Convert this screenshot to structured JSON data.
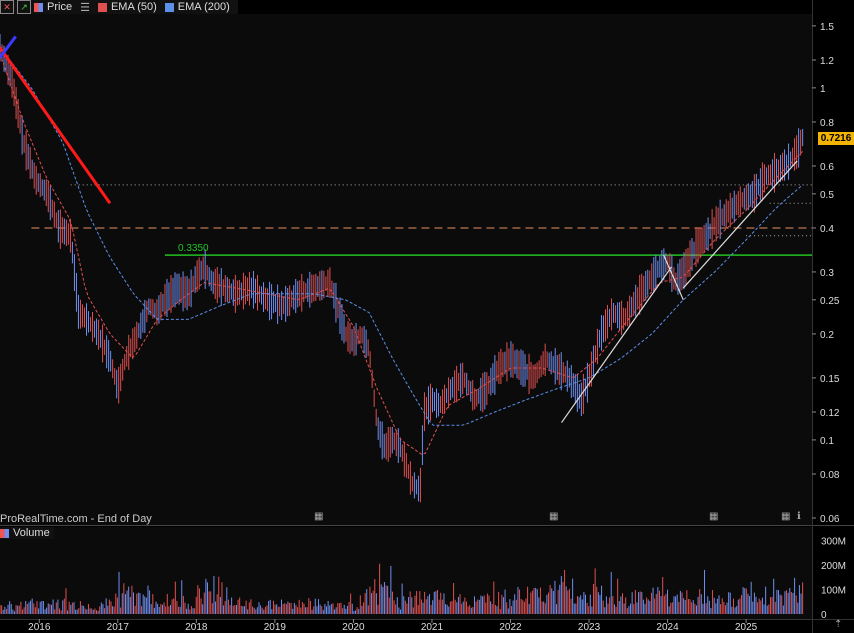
{
  "legend": {
    "price_label": "Price",
    "ema50_label": "EMA (50)",
    "ema200_label": "EMA (200)",
    "price_color": "#6f8ff0",
    "ema50_color": "#e05050",
    "ema200_color": "#5b8fe8"
  },
  "watermark": "ProRealTime.com - End of Day",
  "volume_label": "Volume",
  "last_price": "0.7216",
  "level_label": "0.3350",
  "chart_data": [
    {
      "type": "line",
      "scale": "log",
      "ylim": [
        0.06,
        1.6
      ],
      "xlim": [
        2015.5,
        2025.75
      ],
      "y_ticks": [
        "1.5",
        "1.2",
        "1",
        "0.8",
        "0.7216",
        "0.6",
        "0.5",
        "0.4",
        "0.3",
        "0.25",
        "0.2",
        "0.15",
        "0.12",
        "0.1",
        "0.08",
        "0.06"
      ],
      "y_tick_values": [
        1.5,
        1.2,
        1.0,
        0.8,
        0.7216,
        0.6,
        0.5,
        0.4,
        0.3,
        0.25,
        0.2,
        0.15,
        0.12,
        0.1,
        0.08,
        0.06
      ],
      "series": [
        {
          "name": "Price",
          "x": [
            2015.5,
            2015.65,
            2015.8,
            2015.95,
            2016.1,
            2016.25,
            2016.4,
            2016.5,
            2016.6,
            2016.75,
            2016.9,
            2017.0,
            2017.1,
            2017.25,
            2017.4,
            2017.5,
            2017.6,
            2017.75,
            2017.9,
            2018.0,
            2018.1,
            2018.2,
            2018.35,
            2018.5,
            2018.7,
            2018.9,
            2019.1,
            2019.3,
            2019.5,
            2019.7,
            2019.9,
            2020.0,
            2020.1,
            2020.2,
            2020.3,
            2020.4,
            2020.5,
            2020.6,
            2020.75,
            2020.85,
            2020.9,
            2021.0,
            2021.1,
            2021.25,
            2021.4,
            2021.55,
            2021.7,
            2021.85,
            2022.0,
            2022.15,
            2022.3,
            2022.45,
            2022.6,
            2022.75,
            2022.9,
            2023.0,
            2023.15,
            2023.3,
            2023.45,
            2023.6,
            2023.75,
            2023.9,
            2024.0,
            2024.1,
            2024.2,
            2024.35,
            2024.5,
            2024.65,
            2024.8,
            2024.95,
            2025.1,
            2025.25,
            2025.4,
            2025.55,
            2025.65,
            2025.72
          ],
          "values": [
            1.3,
            1.05,
            0.7,
            0.55,
            0.5,
            0.4,
            0.38,
            0.23,
            0.22,
            0.2,
            0.17,
            0.14,
            0.17,
            0.2,
            0.24,
            0.23,
            0.25,
            0.27,
            0.26,
            0.29,
            0.31,
            0.28,
            0.27,
            0.26,
            0.27,
            0.25,
            0.24,
            0.26,
            0.27,
            0.28,
            0.2,
            0.19,
            0.2,
            0.18,
            0.11,
            0.095,
            0.1,
            0.095,
            0.075,
            0.072,
            0.12,
            0.13,
            0.125,
            0.14,
            0.15,
            0.13,
            0.14,
            0.16,
            0.17,
            0.16,
            0.15,
            0.17,
            0.16,
            0.15,
            0.13,
            0.15,
            0.2,
            0.23,
            0.22,
            0.25,
            0.28,
            0.31,
            0.32,
            0.28,
            0.3,
            0.35,
            0.38,
            0.42,
            0.45,
            0.48,
            0.5,
            0.56,
            0.58,
            0.62,
            0.66,
            0.7216
          ]
        },
        {
          "name": "EMA (50)",
          "x": [
            2015.5,
            2015.8,
            2016.1,
            2016.4,
            2016.6,
            2016.9,
            2017.2,
            2017.5,
            2017.8,
            2018.1,
            2018.5,
            2018.9,
            2019.3,
            2019.7,
            2020.0,
            2020.3,
            2020.6,
            2020.9,
            2021.2,
            2021.6,
            2022.0,
            2022.4,
            2022.8,
            2023.1,
            2023.5,
            2023.9,
            2024.2,
            2024.6,
            2025.0,
            2025.4,
            2025.72
          ],
          "values": [
            1.25,
            0.8,
            0.55,
            0.42,
            0.26,
            0.2,
            0.17,
            0.22,
            0.25,
            0.28,
            0.27,
            0.26,
            0.25,
            0.27,
            0.21,
            0.14,
            0.1,
            0.09,
            0.125,
            0.14,
            0.16,
            0.16,
            0.15,
            0.17,
            0.22,
            0.28,
            0.29,
            0.37,
            0.45,
            0.56,
            0.66
          ]
        },
        {
          "name": "EMA (200)",
          "x": [
            2015.5,
            2015.9,
            2016.3,
            2016.6,
            2016.9,
            2017.2,
            2017.5,
            2017.9,
            2018.3,
            2018.7,
            2019.1,
            2019.5,
            2019.9,
            2020.2,
            2020.5,
            2020.8,
            2021.0,
            2021.4,
            2021.8,
            2022.2,
            2022.6,
            2023.0,
            2023.4,
            2023.8,
            2024.2,
            2024.6,
            2025.0,
            2025.4,
            2025.72
          ],
          "values": [
            1.3,
            1.0,
            0.7,
            0.45,
            0.33,
            0.26,
            0.22,
            0.22,
            0.24,
            0.26,
            0.26,
            0.26,
            0.25,
            0.23,
            0.17,
            0.13,
            0.11,
            0.11,
            0.12,
            0.13,
            0.14,
            0.15,
            0.17,
            0.2,
            0.25,
            0.3,
            0.37,
            0.46,
            0.53
          ]
        }
      ],
      "levels": [
        {
          "name": "0.3350",
          "value": 0.335,
          "color": "#22c422",
          "style": "solid",
          "x_start": 2017.6
        },
        {
          "value": 0.4,
          "color": "#e89060",
          "style": "dashed",
          "x_start": 2015.9
        },
        {
          "value": 0.38,
          "color": "#aaaaaa",
          "style": "dotted",
          "x_start": 2025.0
        },
        {
          "value": 0.47,
          "color": "#aaaaaa",
          "style": "dotted",
          "x_start": 2025.3
        },
        {
          "value": 0.53,
          "color": "#aaaaaa",
          "style": "dotted",
          "x_start": 2016.4
        }
      ],
      "trendlines": [
        {
          "x": [
            2015.5,
            2016.9
          ],
          "y": [
            1.3,
            0.47
          ],
          "color": "#ff1a1a"
        },
        {
          "x": [
            2015.5,
            2015.7
          ],
          "y": [
            1.22,
            1.4
          ],
          "color": "#3a3aff"
        },
        {
          "x": [
            2022.65,
            2024.05
          ],
          "y": [
            0.112,
            0.31
          ],
          "color": "#dddddd"
        },
        {
          "x": [
            2024.2,
            2025.65
          ],
          "y": [
            0.27,
            0.62
          ],
          "color": "#dddddd"
        },
        {
          "x": [
            2023.95,
            2024.2
          ],
          "y": [
            0.335,
            0.25
          ],
          "color": "#dddddd"
        }
      ]
    },
    {
      "type": "bar",
      "title": "Volume",
      "ylim": [
        0,
        330
      ],
      "y_ticks": [
        "300M",
        "200M",
        "100M",
        "0"
      ],
      "y_tick_values": [
        300,
        200,
        100,
        0
      ],
      "x_ticks": [
        "2016",
        "2017",
        "2018",
        "2019",
        "2020",
        "2021",
        "2022",
        "2023",
        "2024",
        "2025"
      ],
      "x_tick_values": [
        2016,
        2017,
        2018,
        2019,
        2020,
        2021,
        2022,
        2023,
        2024,
        2025
      ],
      "x": [
        2015.6,
        2015.9,
        2016.2,
        2016.5,
        2016.8,
        2017.1,
        2017.3,
        2017.6,
        2017.9,
        2018.2,
        2018.5,
        2018.8,
        2019.1,
        2019.4,
        2019.7,
        2020.0,
        2020.3,
        2020.6,
        2020.9,
        2021.2,
        2021.5,
        2021.8,
        2022.1,
        2022.4,
        2022.7,
        2023.0,
        2023.3,
        2023.6,
        2023.9,
        2024.2,
        2024.5,
        2024.8,
        2025.1,
        2025.4,
        2025.65
      ],
      "values": [
        60,
        90,
        100,
        80,
        70,
        200,
        150,
        120,
        110,
        280,
        100,
        80,
        90,
        100,
        80,
        70,
        230,
        120,
        150,
        140,
        120,
        130,
        160,
        200,
        230,
        180,
        160,
        150,
        170,
        140,
        150,
        130,
        200,
        150,
        240
      ]
    }
  ]
}
